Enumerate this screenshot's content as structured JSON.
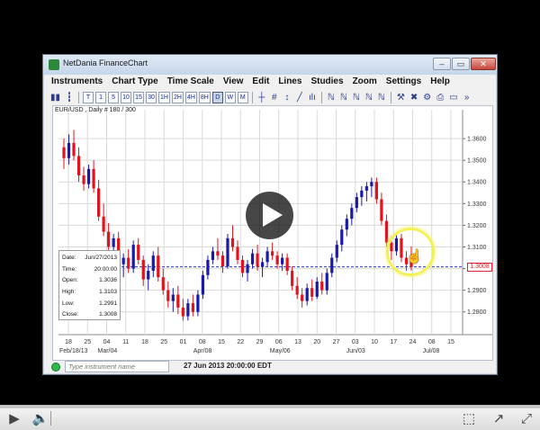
{
  "window": {
    "title": "NetDania FinanceChart",
    "min_glyph": "–",
    "max_glyph": "▭",
    "close_glyph": "✕"
  },
  "menu": [
    "Instruments",
    "Chart Type",
    "Time Scale",
    "View",
    "Edit",
    "Lines",
    "Studies",
    "Zoom",
    "Settings",
    "Help"
  ],
  "toolbar": {
    "intervals": [
      "T",
      "1",
      "5",
      "10",
      "15",
      "30",
      "1H",
      "2H",
      "4H",
      "8H",
      "D",
      "W",
      "M"
    ],
    "selected_interval": "D",
    "more_glyph": "»"
  },
  "chart": {
    "symbol_label": "EUR/USD , Daily # 180 / 300",
    "current_price_label": "1.3008",
    "colors": {
      "up": "#1a1aa8",
      "down": "#e0141e",
      "current_line": "#2b37c9",
      "grid": "#d9d9d9"
    }
  },
  "data_box": {
    "rows": [
      {
        "label": "Date:",
        "value": "Jun/27/2013"
      },
      {
        "label": "Time:",
        "value": "20:00:00"
      },
      {
        "label": "Open:",
        "value": "1.3036"
      },
      {
        "label": "High:",
        "value": "1.3103"
      },
      {
        "label": "Low:",
        "value": "1.2991"
      },
      {
        "label": "Close:",
        "value": "1.3008"
      }
    ]
  },
  "status": {
    "instrument_placeholder": "Type instrument name",
    "datetime": "27 Jun 2013 20:00:00 EDT"
  },
  "player": {
    "progress_fraction": 0.0,
    "play_glyph": "▶",
    "volume_glyph": "🔈",
    "fullscreen_glyph": "⬚",
    "share_glyph": "↗",
    "expand_glyph": "⤢"
  },
  "chart_data": {
    "type": "candlestick",
    "y_ticks": [
      "1.3600",
      "1.3400",
      "1.3200",
      "1.3000",
      "1.2800",
      "1.3500",
      "1.3300",
      "1.3100",
      "1.2900"
    ],
    "ylim": [
      1.272,
      1.37
    ],
    "x_tick_labels": [
      "18",
      "25",
      "04",
      "11",
      "18",
      "25",
      "01",
      "08",
      "15",
      "22",
      "29",
      "06",
      "13",
      "20",
      "27",
      "03",
      "10",
      "17",
      "24",
      "08",
      "15"
    ],
    "month_labels": [
      {
        "text": "Feb/18/13",
        "at": "18"
      },
      {
        "text": "Mar/04",
        "at": "04"
      },
      {
        "text": "Apr/08",
        "at": "08"
      },
      {
        "text": "May/06",
        "at": "06"
      },
      {
        "text": "Jun/03",
        "at": "03"
      },
      {
        "text": "Jul/08",
        "at": "08b"
      }
    ],
    "current_price": 1.3008,
    "candles": [
      [
        1.356,
        1.36,
        1.346,
        1.351
      ],
      [
        1.351,
        1.362,
        1.348,
        1.358
      ],
      [
        1.358,
        1.364,
        1.35,
        1.352
      ],
      [
        1.352,
        1.356,
        1.34,
        1.343
      ],
      [
        1.343,
        1.347,
        1.336,
        1.339
      ],
      [
        1.339,
        1.348,
        1.337,
        1.346
      ],
      [
        1.346,
        1.35,
        1.335,
        1.337
      ],
      [
        1.337,
        1.341,
        1.322,
        1.324
      ],
      [
        1.324,
        1.33,
        1.315,
        1.317
      ],
      [
        1.317,
        1.321,
        1.308,
        1.31
      ],
      [
        1.31,
        1.316,
        1.305,
        1.314
      ],
      [
        1.314,
        1.317,
        1.3,
        1.302
      ],
      [
        1.302,
        1.307,
        1.296,
        1.305
      ],
      [
        1.305,
        1.309,
        1.298,
        1.3
      ],
      [
        1.3,
        1.313,
        1.298,
        1.311
      ],
      [
        1.311,
        1.314,
        1.302,
        1.304
      ],
      [
        1.304,
        1.306,
        1.292,
        1.295
      ],
      [
        1.295,
        1.302,
        1.29,
        1.299
      ],
      [
        1.299,
        1.308,
        1.296,
        1.306
      ],
      [
        1.306,
        1.31,
        1.294,
        1.296
      ],
      [
        1.296,
        1.3,
        1.288,
        1.29
      ],
      [
        1.29,
        1.294,
        1.282,
        1.285
      ],
      [
        1.285,
        1.291,
        1.28,
        1.288
      ],
      [
        1.288,
        1.292,
        1.279,
        1.282
      ],
      [
        1.282,
        1.286,
        1.276,
        1.278
      ],
      [
        1.278,
        1.286,
        1.276,
        1.284
      ],
      [
        1.284,
        1.288,
        1.278,
        1.28
      ],
      [
        1.28,
        1.29,
        1.278,
        1.288
      ],
      [
        1.288,
        1.299,
        1.286,
        1.297
      ],
      [
        1.297,
        1.306,
        1.295,
        1.304
      ],
      [
        1.304,
        1.31,
        1.302,
        1.308
      ],
      [
        1.308,
        1.314,
        1.304,
        1.306
      ],
      [
        1.306,
        1.308,
        1.298,
        1.301
      ],
      [
        1.301,
        1.316,
        1.3,
        1.314
      ],
      [
        1.314,
        1.32,
        1.308,
        1.31
      ],
      [
        1.31,
        1.313,
        1.302,
        1.304
      ],
      [
        1.304,
        1.306,
        1.296,
        1.298
      ],
      [
        1.298,
        1.304,
        1.294,
        1.302
      ],
      [
        1.302,
        1.309,
        1.3,
        1.307
      ],
      [
        1.307,
        1.311,
        1.299,
        1.301
      ],
      [
        1.301,
        1.305,
        1.296,
        1.303
      ],
      [
        1.303,
        1.31,
        1.301,
        1.308
      ],
      [
        1.308,
        1.312,
        1.304,
        1.306
      ],
      [
        1.306,
        1.308,
        1.3,
        1.302
      ],
      [
        1.302,
        1.307,
        1.299,
        1.305
      ],
      [
        1.305,
        1.307,
        1.297,
        1.299
      ],
      [
        1.299,
        1.301,
        1.29,
        1.292
      ],
      [
        1.292,
        1.296,
        1.286,
        1.288
      ],
      [
        1.288,
        1.291,
        1.282,
        1.285
      ],
      [
        1.285,
        1.293,
        1.283,
        1.291
      ],
      [
        1.291,
        1.295,
        1.285,
        1.287
      ],
      [
        1.287,
        1.296,
        1.286,
        1.294
      ],
      [
        1.294,
        1.298,
        1.288,
        1.29
      ],
      [
        1.29,
        1.3,
        1.288,
        1.298
      ],
      [
        1.298,
        1.307,
        1.296,
        1.305
      ],
      [
        1.305,
        1.313,
        1.303,
        1.311
      ],
      [
        1.311,
        1.32,
        1.308,
        1.318
      ],
      [
        1.318,
        1.325,
        1.315,
        1.323
      ],
      [
        1.323,
        1.33,
        1.32,
        1.328
      ],
      [
        1.328,
        1.335,
        1.326,
        1.333
      ],
      [
        1.333,
        1.338,
        1.329,
        1.336
      ],
      [
        1.336,
        1.34,
        1.331,
        1.338
      ],
      [
        1.338,
        1.342,
        1.333,
        1.34
      ],
      [
        1.34,
        1.342,
        1.33,
        1.332
      ],
      [
        1.332,
        1.335,
        1.32,
        1.322
      ],
      [
        1.322,
        1.325,
        1.31,
        1.312
      ],
      [
        1.312,
        1.315,
        1.304,
        1.308
      ],
      [
        1.308,
        1.316,
        1.306,
        1.314
      ],
      [
        1.314,
        1.316,
        1.303,
        1.305
      ],
      [
        1.305,
        1.308,
        1.299,
        1.302
      ],
      [
        1.3036,
        1.3103,
        1.2991,
        1.3008
      ]
    ]
  }
}
